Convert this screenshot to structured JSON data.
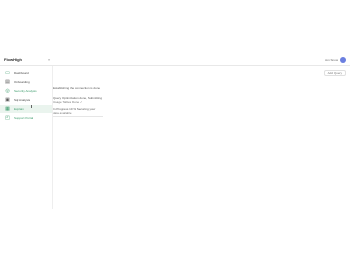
{
  "header": {
    "logo_text": "FlowHigh",
    "collapse_icon": "collapse-icon",
    "user_name": "Jon Snow",
    "avatar_color": "#6b7fe0",
    "accent_color": "#3a9a6a"
  },
  "sidebar": {
    "items": [
      {
        "label": "Dashboard",
        "icon": "dashboard-icon"
      },
      {
        "label": "Onboarding",
        "icon": "onboarding-icon"
      },
      {
        "label": "Security Analysis",
        "icon": "security-icon"
      },
      {
        "label": "Sql Analysis",
        "icon": "sql-icon"
      },
      {
        "label": "Explain",
        "icon": "explain-icon"
      },
      {
        "label": "Support Portal",
        "icon": "support-icon"
      }
    ]
  },
  "main": {
    "button_label": "Add Query",
    "messages": [
      "Establishing the connection is done",
      "Query Optimization done, Submitting",
      "Usage Tables Done ✓",
      "In Progress 10 % Securing your",
      "data available"
    ]
  }
}
